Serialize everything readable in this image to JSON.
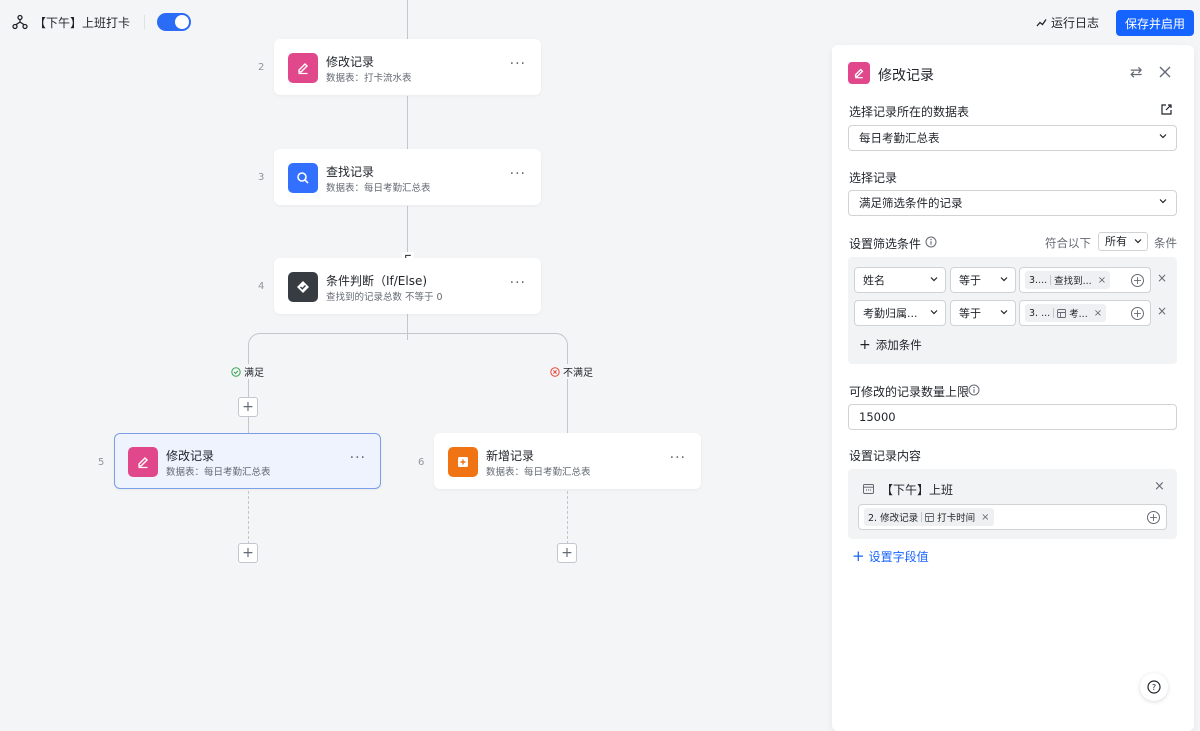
{
  "topbar": {
    "workflow_title": "【下午】上班打卡",
    "enabled": true,
    "run_log": "运行日志",
    "save_enable": "保存并启用"
  },
  "flow": {
    "nodes": [
      {
        "step": "2",
        "title": "修改记录",
        "subtitle": "数据表：打卡流水表",
        "icon": "edit-icon",
        "color": "#e0488b"
      },
      {
        "step": "3",
        "title": "查找记录",
        "subtitle": "数据表：每日考勤汇总表",
        "icon": "search-icon",
        "color": "#3370ff"
      },
      {
        "step": "4",
        "title": "条件判断（If/Else)",
        "subtitle": "查找到的记录总数 不等于 0",
        "icon": "condition-icon",
        "color": "#373c43"
      },
      {
        "step": "5",
        "title": "修改记录",
        "subtitle": "数据表：每日考勤汇总表",
        "icon": "edit-icon",
        "color": "#e0488b"
      },
      {
        "step": "6",
        "title": "新增记录",
        "subtitle": "数据表：每日考勤汇总表",
        "icon": "add-record-icon",
        "color": "#f07413"
      }
    ],
    "branch_yes": "满足",
    "branch_no": "不满足",
    "more": "···"
  },
  "panel": {
    "title": "修改记录",
    "table_label": "选择记录所在的数据表",
    "table_value": "每日考勤汇总表",
    "record_label": "选择记录",
    "record_value": "满足筛选条件的记录",
    "filter_label": "设置筛选条件",
    "match_prefix": "符合以下",
    "match_value": "所有",
    "match_suffix": "条件",
    "conditions": [
      {
        "field": "姓名",
        "op": "等于",
        "tag_a": "3....",
        "tag_b": "查找到..."
      },
      {
        "field": "考勤归属...",
        "op": "等于",
        "tag_a": "3. ...",
        "tag_b": "考..."
      }
    ],
    "add_condition": "添加条件",
    "limit_label": "可修改的记录数量上限",
    "limit_value": "15000",
    "content_label": "设置记录内容",
    "content_field": "【下午】上班",
    "content_tag_a": "2. 修改记录",
    "content_tag_b": "打卡时间",
    "add_field_value": "设置字段值",
    "help": "?"
  }
}
